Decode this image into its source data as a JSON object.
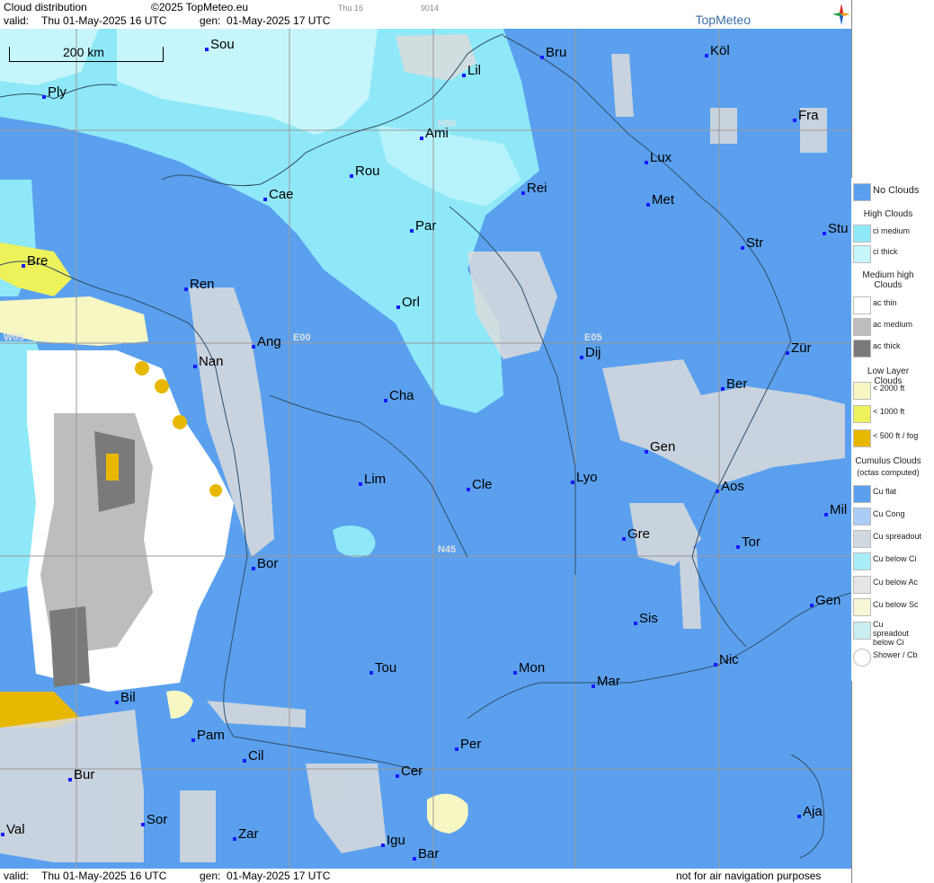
{
  "header": {
    "title": "Cloud distribution",
    "copyright": "©2025 TopMeteo.eu",
    "valid_label": "valid:",
    "valid_value": "Thu  01-May-2025  16 UTC",
    "gen_label": "gen:",
    "gen_value": "01-May-2025 17 UTC",
    "small_time": "Thu 16",
    "small_code": "9014",
    "brand": "TopMeteo"
  },
  "footer": {
    "valid_label": "valid:",
    "valid_value": "Thu  01-May-2025  16 UTC",
    "gen_label": "gen:",
    "gen_value": "01-May-2025 17 UTC",
    "disclaimer": "not for air navigation purposes"
  },
  "map": {
    "scale_label": "200 km",
    "grid_labels": [
      "N50",
      "N45",
      "E00",
      "E05",
      "W05"
    ],
    "colors": {
      "no_clouds": "#5aa0ee",
      "ci_medium": "#8ee8f8",
      "ci_thick": "#c6f6fb",
      "ac_thin": "#ffffff",
      "ac_medium": "#bdbdbd",
      "ac_thick": "#7a7a7a",
      "low_2000": "#f7f7c4",
      "low_1000": "#eef25a",
      "low_500": "#e8b800"
    },
    "cities": [
      "Sou",
      "Bru",
      "Köl",
      "Lil",
      "Ply",
      "Ami",
      "Fra",
      "Lux",
      "Rou",
      "Cae",
      "Rei",
      "Met",
      "Par",
      "Stu",
      "Str",
      "Bre",
      "Ren",
      "Orl",
      "Ang",
      "Dij",
      "Zür",
      "Nan",
      "Cha",
      "Ber",
      "Gen",
      "Lim",
      "Cle",
      "Lyo",
      "Aos",
      "Mil",
      "Gre",
      "Tor",
      "Bor",
      "Gen",
      "Sis",
      "Nic",
      "Tou",
      "Mon",
      "Mar",
      "Bil",
      "Pam",
      "Per",
      "Cil",
      "Bur",
      "Cer",
      "Sor",
      "Aja",
      "Val",
      "Zar",
      "Igu",
      "Bar"
    ]
  },
  "legend": {
    "no_clouds": "No Clouds",
    "high_clouds": "High Clouds",
    "ci_medium": "ci medium",
    "ci_thick": "ci thick",
    "medium_high": "Medium high Clouds",
    "ac_thin": "ac thin",
    "ac_medium": "ac medium",
    "ac_thick": "ac thick",
    "low_layer": "Low Layer Clouds",
    "lt2000": "< 2000 ft",
    "lt1000": "< 1000 ft",
    "lt500": "< 500 ft / fog",
    "cumulus": "Cumulus Clouds",
    "cumulus_sub": "(octas computed)",
    "cu_flat": "Cu flat",
    "cu_cong": "Cu Cong",
    "cu_spread": "Cu spreadout",
    "cu_below_ci": "Cu below Ci",
    "cu_below_ac": "Cu below Ac",
    "cu_below_sc": "Cu below Sc",
    "cu_spread_ci": "Cu spreadout below Ci",
    "shower": "Shower / Cb"
  }
}
